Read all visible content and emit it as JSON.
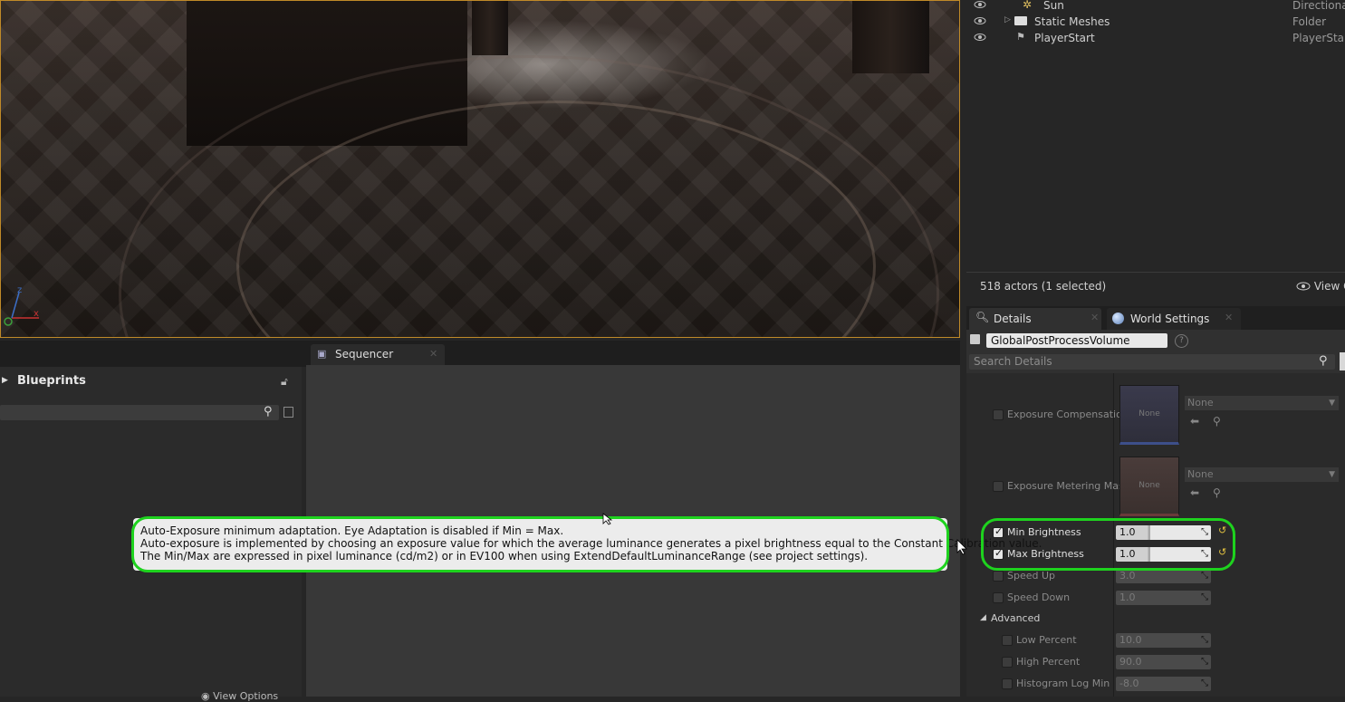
{
  "outliner": {
    "rows": [
      {
        "name": "Sun",
        "type": "DirectionalLig"
      },
      {
        "name": "Static Meshes",
        "type": "Folder"
      },
      {
        "name": "PlayerStart",
        "type": "PlayerStart"
      }
    ],
    "actor_count": "518 actors (1 selected)",
    "view_options": "View O"
  },
  "details": {
    "tabs": [
      {
        "label": "Details",
        "icon": "magnifier-icon"
      },
      {
        "label": "World Settings",
        "icon": "globe-icon"
      }
    ],
    "actor_name": "GlobalPostProcessVolume",
    "search_placeholder": "Search Details",
    "exposure_compensation": {
      "label": "Exposure Compensatio",
      "thumb": "None",
      "combo": "None"
    },
    "exposure_metering": {
      "label": "Exposure Metering Mas",
      "thumb": "None",
      "combo": "None"
    },
    "min_brightness": {
      "label": "Min Brightness",
      "value": "1.0"
    },
    "max_brightness": {
      "label": "Max Brightness",
      "value": "1.0"
    },
    "speed_up": {
      "label": "Speed Up",
      "value": "3.0"
    },
    "speed_down": {
      "label": "Speed Down",
      "value": "1.0"
    },
    "advanced_label": "Advanced",
    "low_percent": {
      "label": "Low Percent",
      "value": "10.0"
    },
    "high_percent": {
      "label": "High Percent",
      "value": "90.0"
    },
    "histogram_log_min": {
      "label": "Histogram Log Min",
      "value": "-8.0"
    }
  },
  "blueprints": {
    "title": "Blueprints",
    "view_options": "View Options"
  },
  "sequencer": {
    "tab_label": "Sequencer"
  },
  "tooltip": {
    "line1": "Auto-Exposure minimum adaptation. Eye Adaptation is disabled if Min = Max.",
    "line2": "Auto-exposure is implemented by choosing an exposure value for which the average luminance generates a pixel brightness equal to the Constant Calibration value.",
    "line3": "The Min/Max are expressed in pixel luminance (cd/m2) or in EV100 when using ExtendDefaultLuminanceRange (see project settings)."
  },
  "colors": {
    "highlight": "#1ed21e",
    "viewport_border": "#c08a28"
  }
}
